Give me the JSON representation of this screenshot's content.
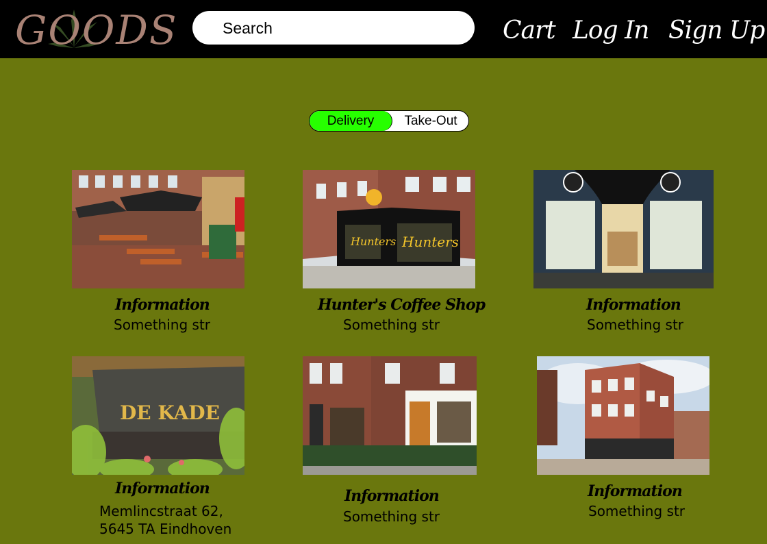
{
  "header": {
    "logo_text": "GOODS",
    "search_placeholder": "Search",
    "nav": {
      "cart": "Cart",
      "login": "Log In",
      "signup": "Sign Up"
    }
  },
  "toggle": {
    "delivery": "Delivery",
    "takeout": "Take-Out",
    "selected": "Delivery"
  },
  "colors": {
    "background": "#6a770d",
    "header": "#000000",
    "toggle_active": "#27ff00",
    "logo": "#a98275"
  },
  "cards": [
    {
      "title": "Information",
      "subtitle": "Something str"
    },
    {
      "title": "Hunter's Coffee Shop",
      "subtitle": "Something str"
    },
    {
      "title": "Information",
      "subtitle": "Something str"
    },
    {
      "title": "Information",
      "address_line1": "Memlincstraat 62,",
      "address_line2": "5645 TA Eindhoven"
    },
    {
      "title": "Information",
      "subtitle": "Something str"
    },
    {
      "title": "Information",
      "subtitle": "Something str"
    }
  ]
}
